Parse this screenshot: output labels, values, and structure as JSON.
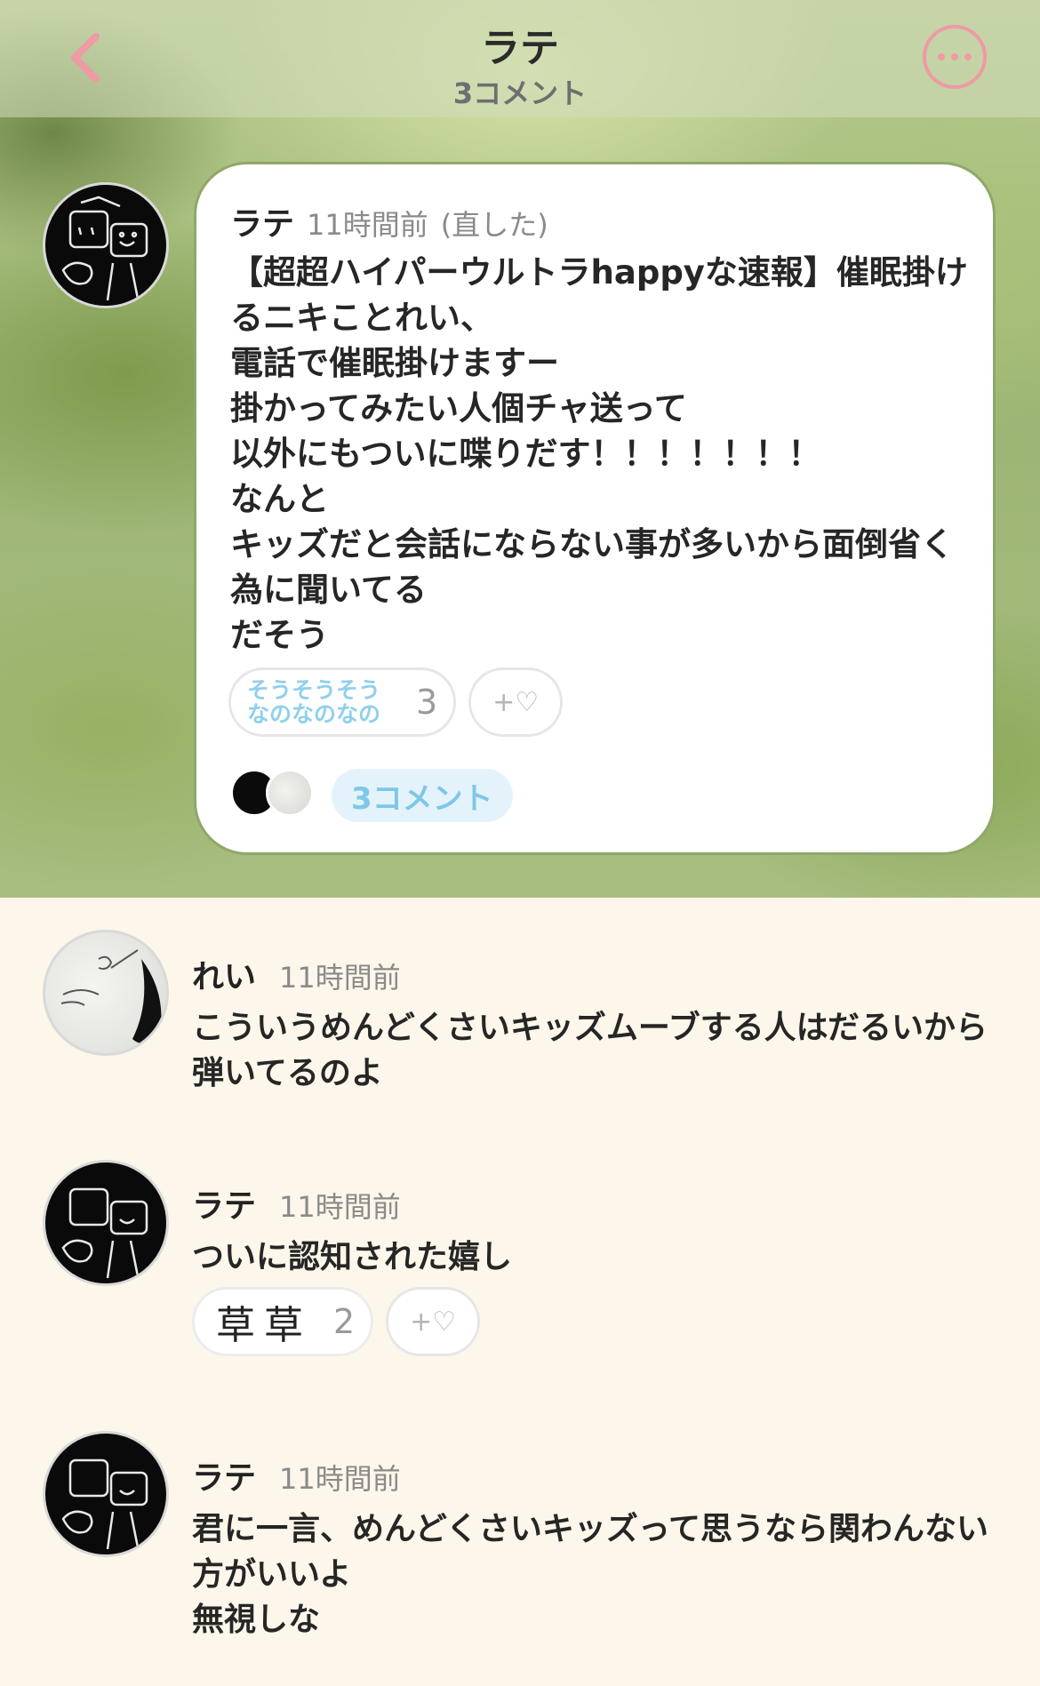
{
  "header": {
    "back_icon": "chevron-left-icon",
    "title": "ラテ",
    "subtitle": "3コメント",
    "more_icon": "ellipsis-icon",
    "accent_color": "#ef9aa4"
  },
  "post": {
    "author": "ラテ",
    "time": "11時間前",
    "edited": "(直した)",
    "body": "【超超ハイパーウルトラhappyな速報】催眠掛けるニキことれい、\n電話で催眠掛けますー\n掛かってみたい人個チャ送って\n以外にもついに喋りだす！！！！！！！\nなんと\nキッズだと会話にならない事が多いから面倒省く為に聞いてる\nだそう",
    "reactions": [
      {
        "stamp_text": "そうそうそう\nなのなのなの",
        "count": "3"
      }
    ],
    "add_reaction_label": "+♡",
    "comments_label": "3コメント"
  },
  "comments": [
    {
      "author": "れい",
      "time": "11時間前",
      "body": "こういうめんどくさいキッズムーブする人はだるいから弾いてるのよ"
    },
    {
      "author": "ラテ",
      "time": "11時間前",
      "body": "ついに認知された嬉し",
      "reaction": {
        "stamp_text": "草草",
        "count": "2"
      },
      "add_reaction_label": "+♡"
    },
    {
      "author": "ラテ",
      "time": "11時間前",
      "body": "君に一言、めんどくさいキッズって思うなら関わんない方がいいよ\n無視しな"
    }
  ]
}
